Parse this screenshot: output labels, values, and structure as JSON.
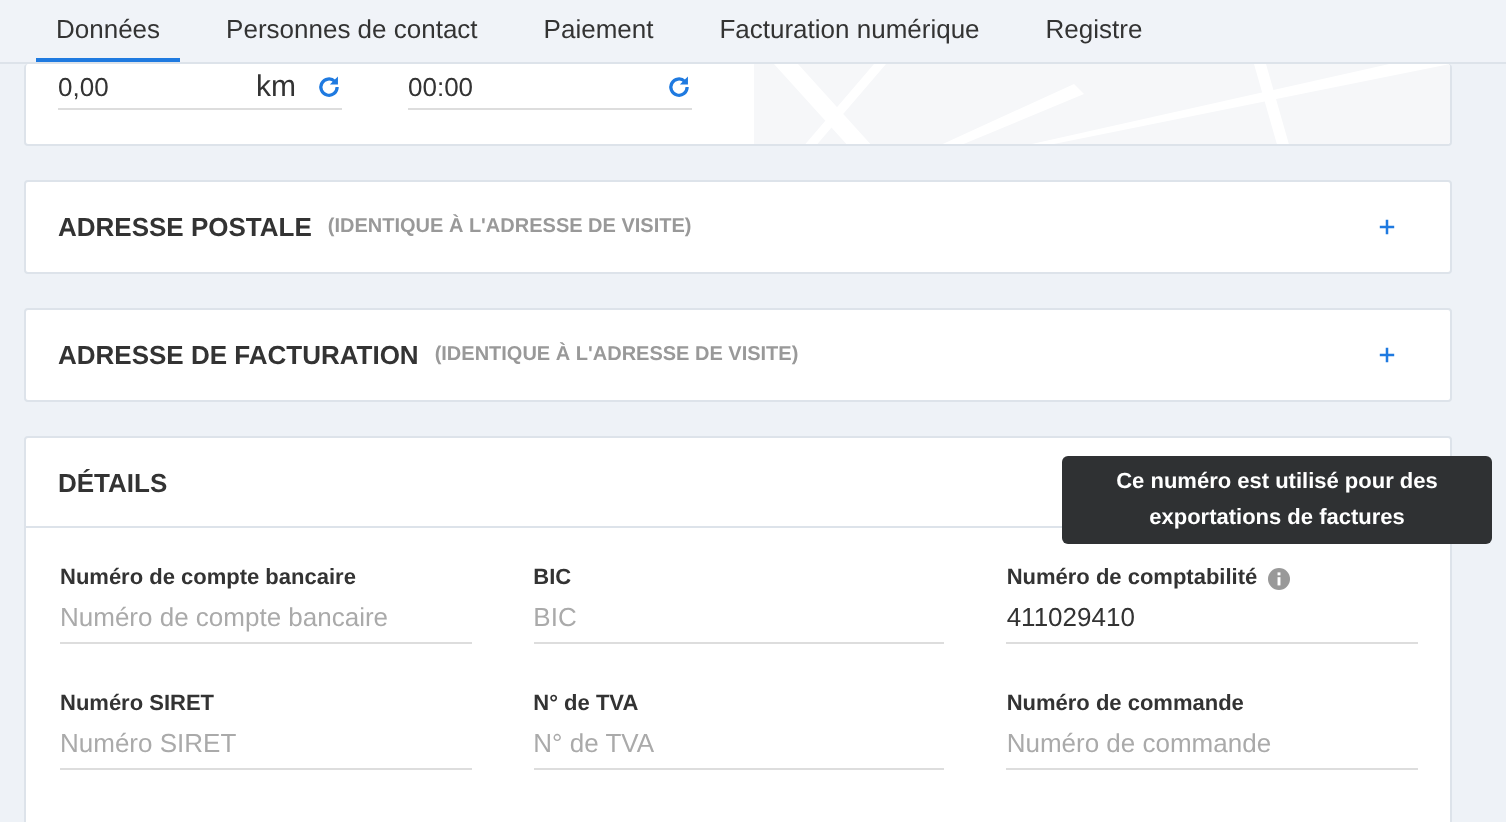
{
  "tabs": [
    {
      "label": "Données",
      "selected": true
    },
    {
      "label": "Personnes de contact",
      "selected": false
    },
    {
      "label": "Paiement",
      "selected": false
    },
    {
      "label": "Facturation numérique",
      "selected": false
    },
    {
      "label": "Registre",
      "selected": false
    }
  ],
  "top_card": {
    "distance": {
      "value": "0,00",
      "unit": "km"
    },
    "time": {
      "value": "00:00"
    }
  },
  "sections": [
    {
      "title": "ADRESSE POSTALE",
      "note": "(IDENTIQUE À L'ADRESSE DE VISITE)",
      "expanded": false
    },
    {
      "title": "ADRESSE DE FACTURATION",
      "note": "(IDENTIQUE À L'ADRESSE DE VISITE)",
      "expanded": false
    }
  ],
  "details": {
    "title": "DÉTAILS",
    "fields": [
      {
        "label": "Numéro de compte bancaire",
        "placeholder": "Numéro de compte bancaire"
      },
      {
        "label": "BIC",
        "placeholder": "BIC"
      },
      {
        "label": "Numéro de comptabilité",
        "value": "411029410",
        "info": true
      },
      {
        "label": "Numéro SIRET",
        "placeholder": "Numéro SIRET"
      },
      {
        "label": "N° de TVA",
        "placeholder": "N° de TVA"
      },
      {
        "label": "Numéro de commande",
        "placeholder": "Numéro de commande"
      }
    ]
  },
  "tooltip": "Ce numéro est utilisé pour des exportations de factures"
}
